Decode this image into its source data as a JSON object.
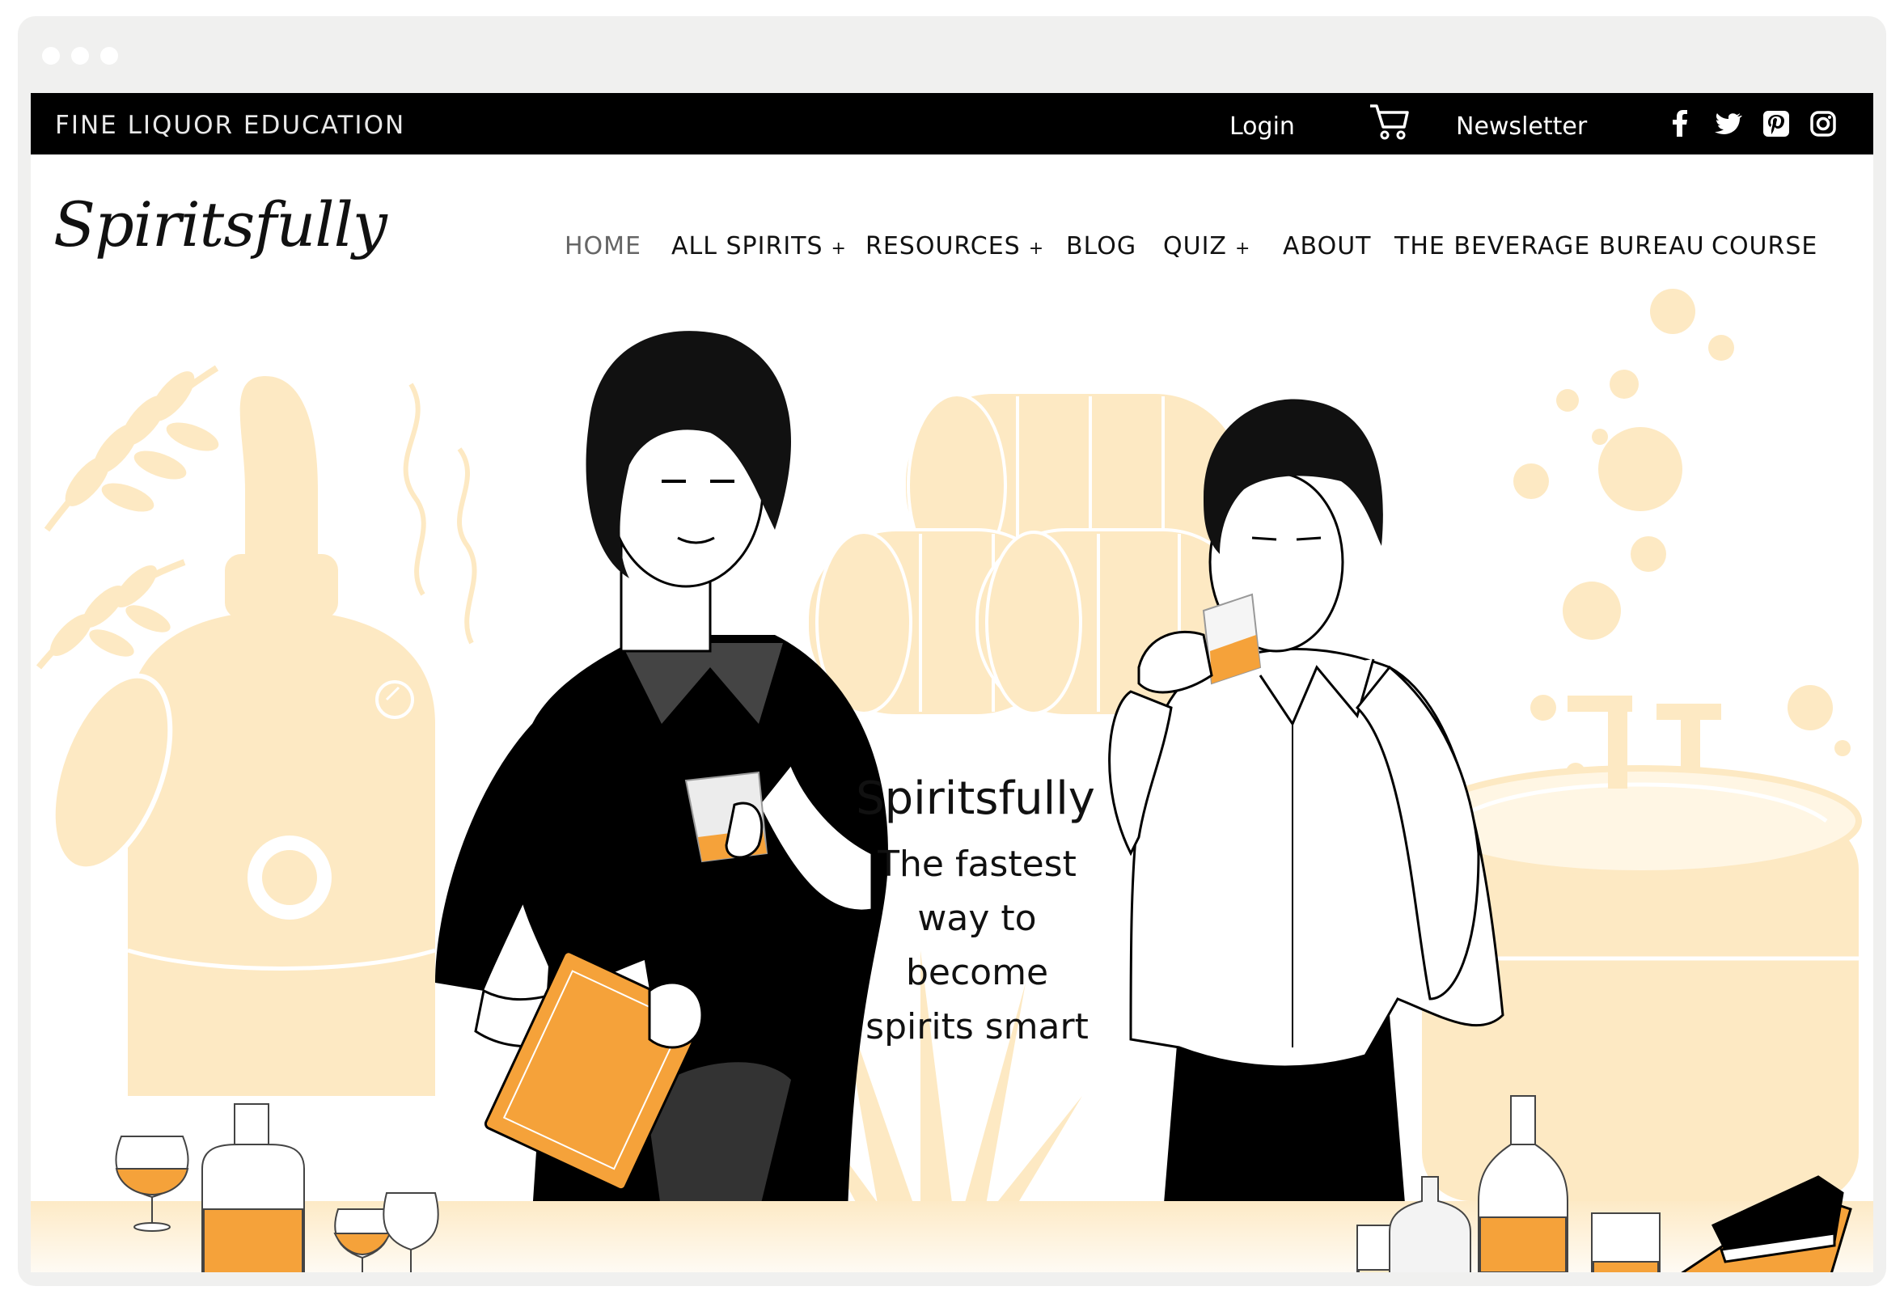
{
  "window": {
    "controls": [
      "dot",
      "dot",
      "dot"
    ]
  },
  "topbar": {
    "tagline": "FINE LIQUOR EDUCATION",
    "login": "Login",
    "newsletter": "Newsletter",
    "icons": [
      "cart-icon",
      "facebook-icon",
      "twitter-icon",
      "pinterest-icon",
      "instagram-icon"
    ]
  },
  "header": {
    "logo": "Spiritsfully",
    "nav": [
      {
        "label": "HOME",
        "active": true
      },
      {
        "label": "ALL SPIRITS",
        "plus": "+"
      },
      {
        "label": "RESOURCES",
        "plus": "+"
      },
      {
        "label": "BLOG"
      },
      {
        "label": "QUIZ",
        "plus": "+"
      },
      {
        "label": "ABOUT"
      },
      {
        "label": "THE BEVERAGE BUREAU"
      },
      {
        "label": "COURSE"
      }
    ]
  },
  "hero": {
    "title": "Spiritsfully",
    "subtitle_lines": [
      "The fastest",
      "way to",
      "become",
      "spirits smart"
    ]
  },
  "colors": {
    "accent": "#f5a23a",
    "pale": "#fde9c3",
    "bar": "#000000"
  }
}
